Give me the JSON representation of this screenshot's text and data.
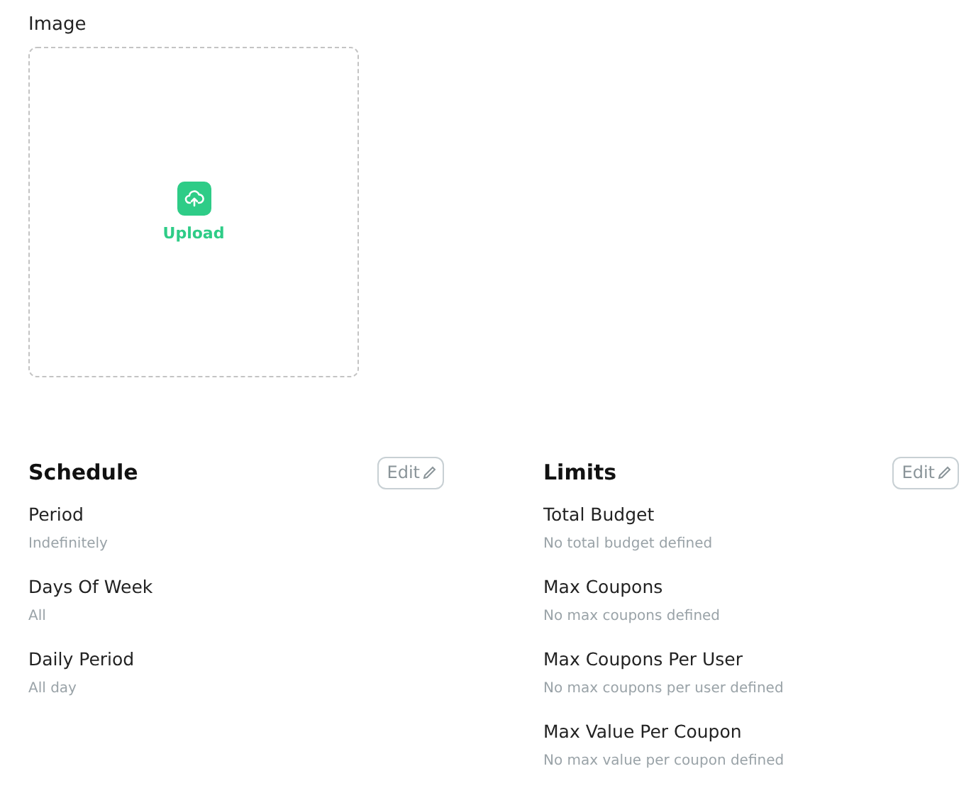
{
  "image": {
    "label": "Image",
    "upload": "Upload"
  },
  "sections": [
    {
      "title": "Schedule",
      "edit": "Edit",
      "fields": [
        {
          "label": "Period",
          "value": "Indefinitely"
        },
        {
          "label": "Days Of Week",
          "value": "All"
        },
        {
          "label": "Daily Period",
          "value": "All day"
        }
      ]
    },
    {
      "title": "Limits",
      "edit": "Edit",
      "fields": [
        {
          "label": "Total Budget",
          "value": "No total budget defined"
        },
        {
          "label": "Max Coupons",
          "value": "No max coupons defined"
        },
        {
          "label": "Max Coupons Per User",
          "value": "No max coupons per user defined"
        },
        {
          "label": "Max Value Per Coupon",
          "value": "No max value per coupon defined"
        }
      ]
    }
  ]
}
